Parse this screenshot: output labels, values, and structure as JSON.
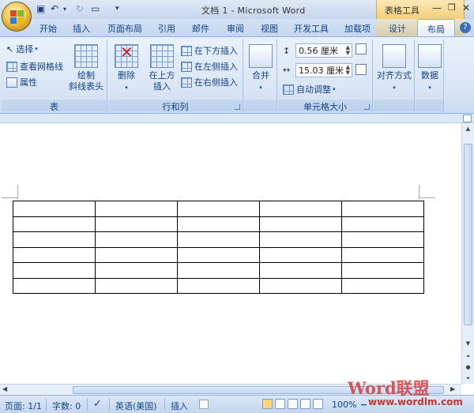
{
  "window": {
    "title": "文档 1 - Microsoft Word",
    "context_header": "表格工具"
  },
  "tabs": [
    "开始",
    "插入",
    "页面布局",
    "引用",
    "邮件",
    "审阅",
    "视图",
    "开发工具",
    "加载项",
    "设计",
    "布局"
  ],
  "active_tab": "布局",
  "ribbon": {
    "table_group": {
      "label": "表",
      "select": "选择",
      "view_gridlines": "查看网格线",
      "properties": "属性",
      "draw_diagonal_line1": "绘制",
      "draw_diagonal_line2": "斜线表头"
    },
    "rows_cols_group": {
      "label": "行和列",
      "delete": "删除",
      "insert_above_line1": "在上方",
      "insert_above_line2": "插入",
      "insert_below": "在下方插入",
      "insert_left": "在左侧插入",
      "insert_right": "在右侧插入"
    },
    "merge_group": {
      "merge": "合并"
    },
    "cell_size_group": {
      "label": "单元格大小",
      "height_value": "0.56 厘米",
      "width_value": "15.03 厘米",
      "autofit": "自动调整"
    },
    "alignment_group": {
      "alignment": "对齐方式"
    },
    "data_group": {
      "data": "数据"
    }
  },
  "document": {
    "table_rows": 6,
    "table_cols": 5
  },
  "statusbar": {
    "page": "页面: 1/1",
    "word_count": "字数: 0",
    "language": "英语(美国)",
    "insert_mode": "插入",
    "zoom": "100%"
  },
  "watermark": {
    "brand": "Word联盟",
    "url": "www.wordlm.com"
  },
  "colors": {
    "ribbon_bg": "#dbe7f5",
    "context_tab": "#f5cf78",
    "accent_text": "#15428b"
  }
}
